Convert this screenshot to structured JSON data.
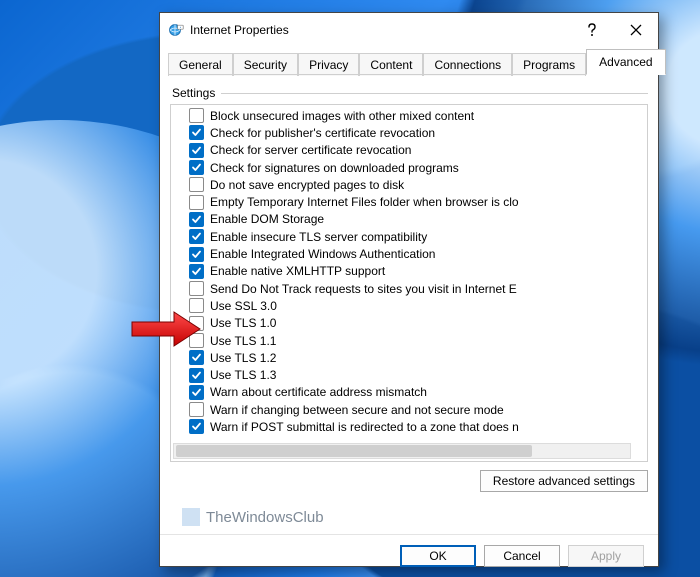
{
  "window": {
    "title": "Internet Properties"
  },
  "tabs": {
    "items": [
      {
        "label": "General"
      },
      {
        "label": "Security"
      },
      {
        "label": "Privacy"
      },
      {
        "label": "Content"
      },
      {
        "label": "Connections"
      },
      {
        "label": "Programs"
      },
      {
        "label": "Advanced"
      }
    ],
    "active_index": 6
  },
  "group": {
    "label": "Settings"
  },
  "settings": [
    {
      "label": "Block unsecured images with other mixed content",
      "checked": false
    },
    {
      "label": "Check for publisher's certificate revocation",
      "checked": true
    },
    {
      "label": "Check for server certificate revocation",
      "checked": true
    },
    {
      "label": "Check for signatures on downloaded programs",
      "checked": true
    },
    {
      "label": "Do not save encrypted pages to disk",
      "checked": false
    },
    {
      "label": "Empty Temporary Internet Files folder when browser is clo",
      "checked": false
    },
    {
      "label": "Enable DOM Storage",
      "checked": true
    },
    {
      "label": "Enable insecure TLS server compatibility",
      "checked": true
    },
    {
      "label": "Enable Integrated Windows Authentication",
      "checked": true
    },
    {
      "label": "Enable native XMLHTTP support",
      "checked": true
    },
    {
      "label": "Send Do Not Track requests to sites you visit in Internet E",
      "checked": false
    },
    {
      "label": "Use SSL 3.0",
      "checked": false
    },
    {
      "label": "Use TLS 1.0",
      "checked": false
    },
    {
      "label": "Use TLS 1.1",
      "checked": false
    },
    {
      "label": "Use TLS 1.2",
      "checked": true
    },
    {
      "label": "Use TLS 1.3",
      "checked": true
    },
    {
      "label": "Warn about certificate address mismatch",
      "checked": true
    },
    {
      "label": "Warn if changing between secure and not secure mode",
      "checked": false
    },
    {
      "label": "Warn if POST submittal is redirected to a zone that does n",
      "checked": true
    }
  ],
  "buttons": {
    "restore": "Restore advanced settings",
    "ok": "OK",
    "cancel": "Cancel",
    "apply": "Apply"
  },
  "watermark": {
    "text": "TheWindowsClub"
  }
}
